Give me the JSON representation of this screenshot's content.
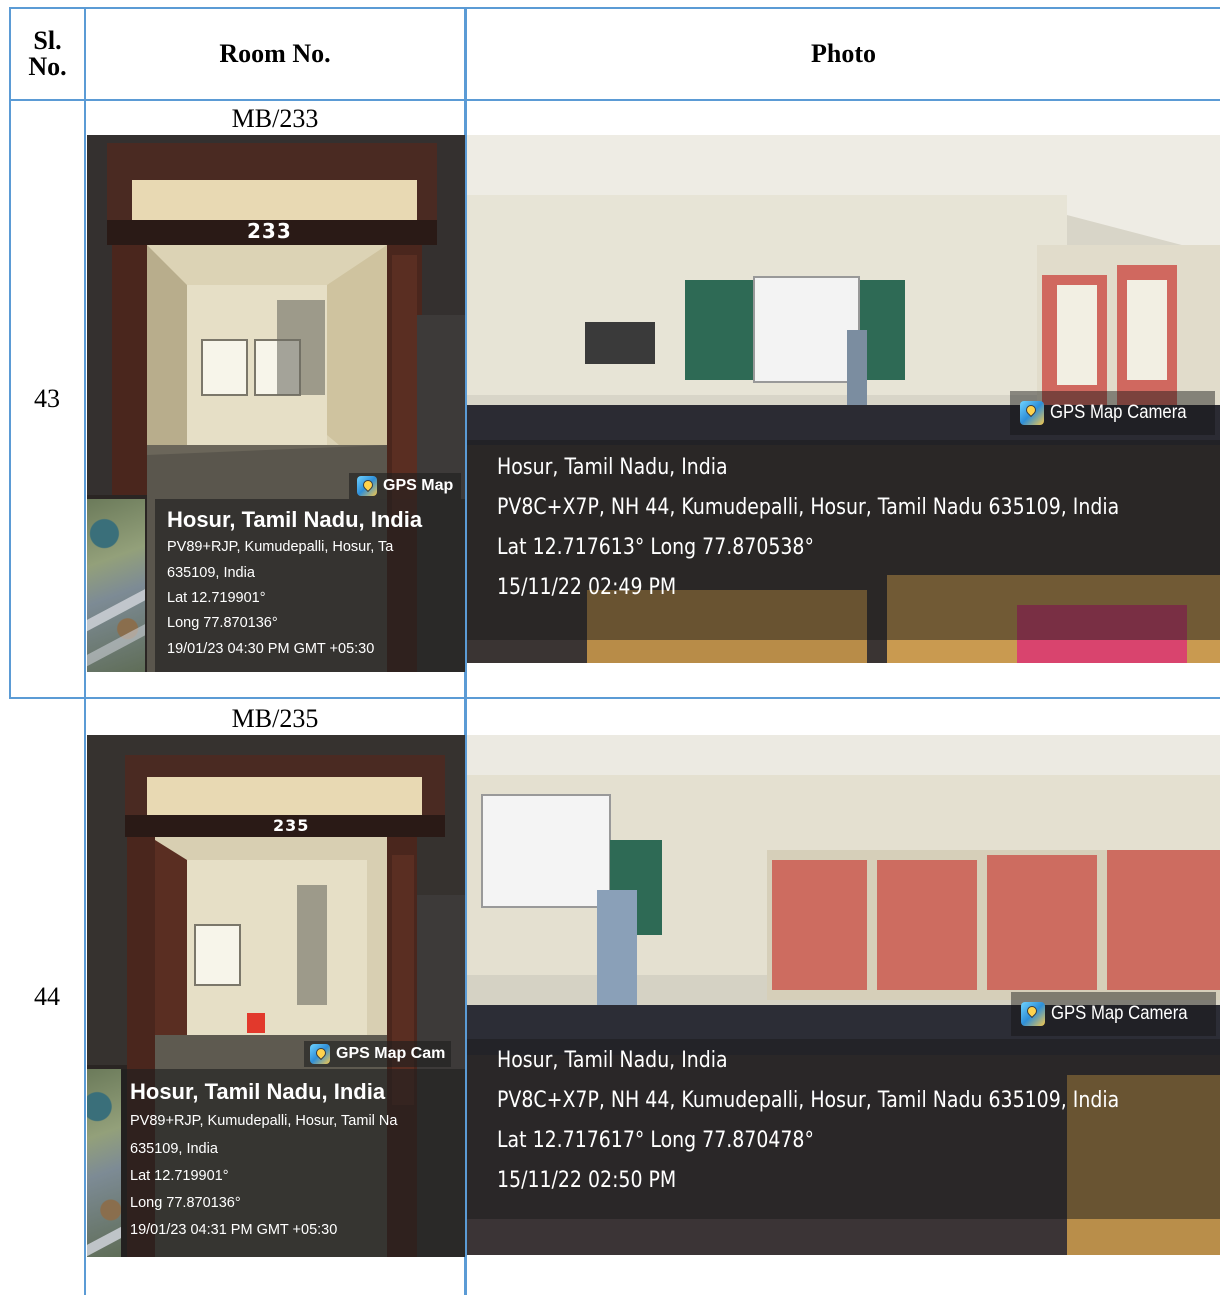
{
  "table": {
    "headers": {
      "sl_no": "Sl. No.",
      "room_no": "Room No.",
      "photo": "Photo"
    },
    "rows": [
      {
        "sl_no": "43",
        "room": "MB/233",
        "door_number": "233",
        "door_overlay": {
          "badge": "GPS Map",
          "city": "Hosur, Tamil Nadu, India",
          "address": "PV89+RJP, Kumudepalli, Hosur, Ta",
          "postal": "635109, India",
          "lat": "Lat 12.719901°",
          "long": "Long 77.870136°",
          "timestamp": "19/01/23 04:30 PM GMT +05:30"
        },
        "class_overlay": {
          "badge": "GPS Map Camera",
          "city": "Hosur, Tamil Nadu, India",
          "address": "PV8C+X7P, NH 44, Kumudepalli, Hosur, Tamil Nadu 635109, India",
          "latlong": "Lat 12.717613° Long 77.870538°",
          "timestamp": "15/11/22 02:49 PM"
        }
      },
      {
        "sl_no": "44",
        "room": "MB/235",
        "door_number": "235",
        "door_overlay": {
          "badge": "GPS Map Cam",
          "city": "Hosur, Tamil Nadu, India",
          "address": "PV89+RJP, Kumudepalli, Hosur, Tamil Na",
          "postal": "635109, India",
          "lat": "Lat 12.719901°",
          "long": "Long 77.870136°",
          "timestamp": "19/01/23 04:31 PM GMT +05:30"
        },
        "class_overlay": {
          "badge": "GPS Map Camera",
          "city": "Hosur, Tamil Nadu, India",
          "address": "PV8C+X7P, NH 44, Kumudepalli, Hosur, Tamil Nadu 635109, India",
          "latlong": "Lat 12.717617° Long 77.870478°",
          "timestamp": "15/11/22 02:50 PM"
        }
      }
    ]
  },
  "colors": {
    "grid_border": "#5b9bd5"
  }
}
